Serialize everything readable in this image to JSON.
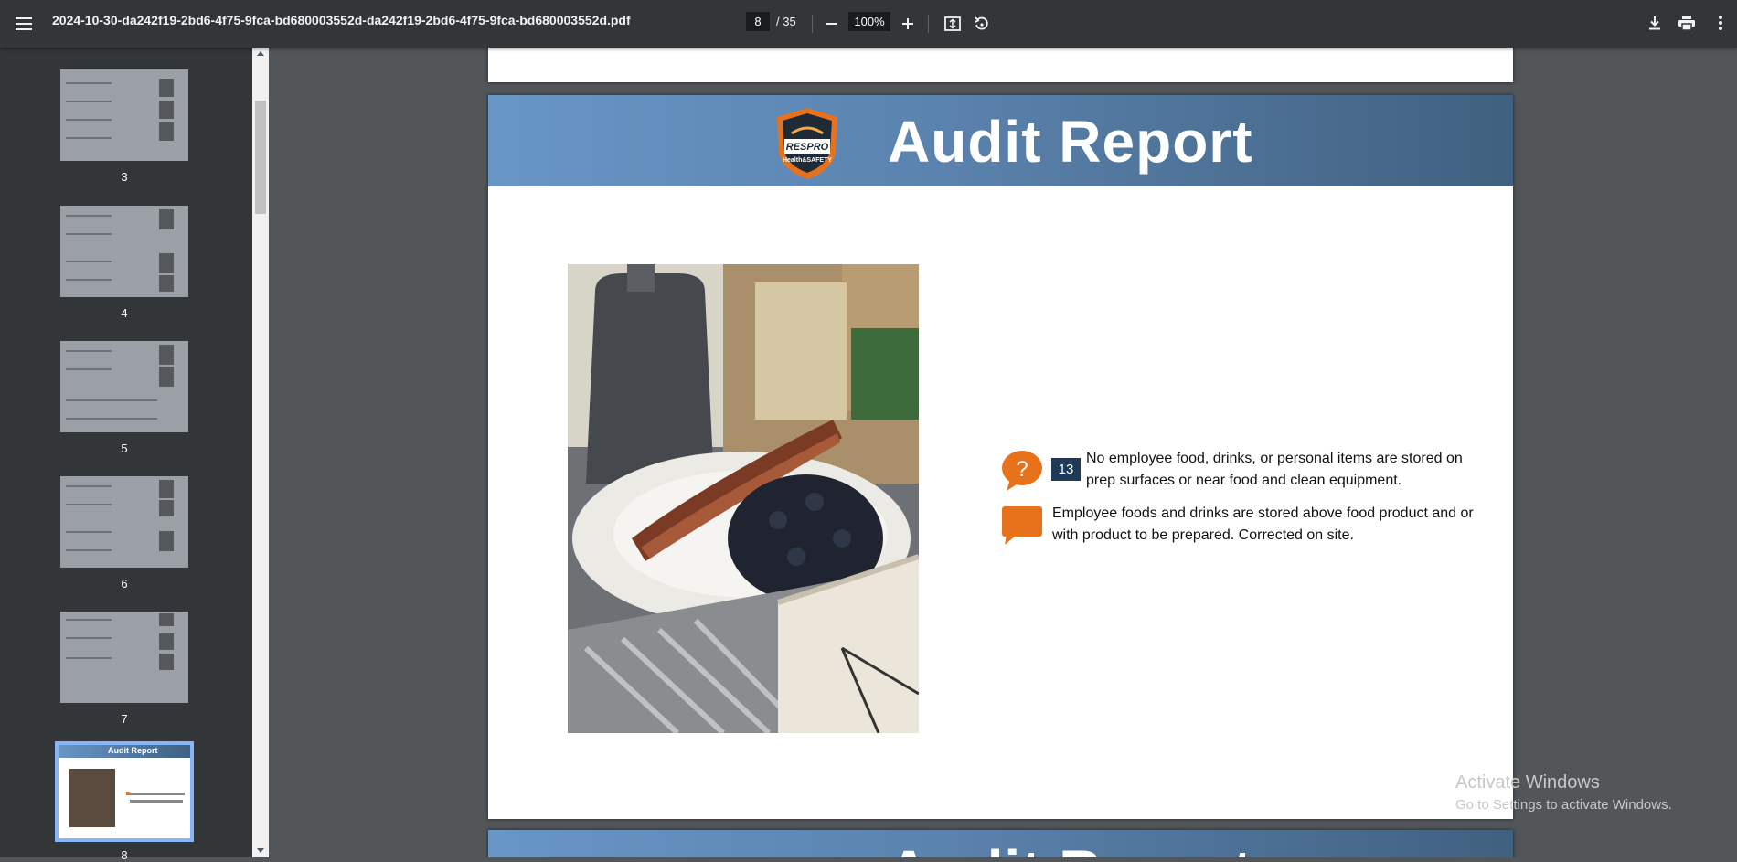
{
  "toolbar": {
    "menu_icon": "hamburger-menu-icon",
    "filename": "2024-10-30-da242f19-2bd6-4f75-9fca-bd680003552d-da242f19-2bd6-4f75-9fca-bd680003552d.pdf",
    "current_page": "8",
    "total_pages": "/ 35",
    "zoom": "100%",
    "icons": [
      "zoom-out-icon",
      "zoom-in-icon",
      "fit-page-icon",
      "rotate-icon",
      "download-icon",
      "print-icon",
      "more-options-icon"
    ]
  },
  "sidebar": {
    "thumbnails": [
      {
        "label": "3"
      },
      {
        "label": "4"
      },
      {
        "label": "5"
      },
      {
        "label": "6"
      },
      {
        "label": "7"
      },
      {
        "label": "8",
        "title": "Audit Report",
        "selected": true
      }
    ]
  },
  "page": {
    "banner_title": "Audit Report",
    "logo_brand": "RESPRO",
    "logo_sub": "Health&SAFETY",
    "finding_number": "13",
    "finding_question": "No employee food, drinks, or personal items are stored on prep surfaces or near food and clean equipment.",
    "finding_comment": "Employee foods and drinks are stored above food product and or with product to be prepared. Corrected on site.",
    "accent_color": "#e8711c",
    "badge_color": "#1f3a56"
  },
  "next_page": {
    "banner_title": "Audit Report"
  },
  "watermark": {
    "line1": "Activate Windows",
    "line2": "Go to Settings to activate Windows."
  }
}
